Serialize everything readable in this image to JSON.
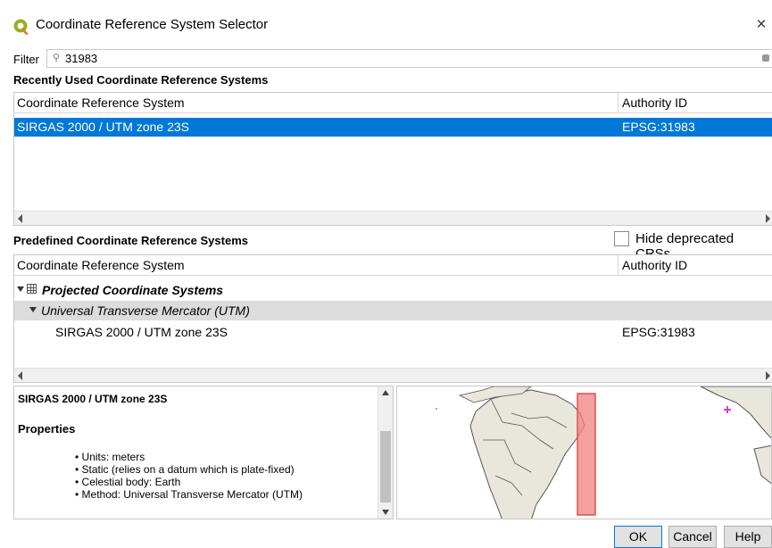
{
  "window": {
    "title": "Coordinate Reference System Selector",
    "close_glyph": "×",
    "logo_icon": "qgis-logo-icon"
  },
  "filter": {
    "label": "Filter",
    "value": "31983",
    "icon": "search-icon"
  },
  "recent": {
    "heading": "Recently Used Coordinate Reference Systems",
    "columns": [
      "Coordinate Reference System",
      "Authority ID"
    ],
    "rows": [
      {
        "name": "SIRGAS 2000 / UTM zone 23S",
        "authority": "EPSG:31983",
        "selected": true
      }
    ]
  },
  "predefined": {
    "heading": "Predefined Coordinate Reference Systems",
    "hide_deprecated_label": "Hide deprecated CRSs",
    "hide_deprecated_checked": false,
    "columns": [
      "Coordinate Reference System",
      "Authority ID"
    ],
    "group": "Projected Coordinate Systems",
    "subgroup": "Universal Transverse Mercator (UTM)",
    "rows": [
      {
        "name": "SIRGAS 2000 / UTM zone 23S",
        "authority": "EPSG:31983"
      }
    ]
  },
  "info": {
    "title": "SIRGAS 2000 / UTM zone 23S",
    "properties_heading": "Properties",
    "properties": [
      "Units: meters",
      "Static (relies on a datum which is plate-fixed)",
      "Celestial body: Earth",
      "Method: Universal Transverse Mercator (UTM)"
    ]
  },
  "colors": {
    "selection": "#0078d7",
    "extent_fill": "#f08080",
    "land": "#e9e6dc",
    "marker": "#cc44cc"
  },
  "buttons": {
    "ok": "OK",
    "cancel": "Cancel",
    "help": "Help"
  }
}
